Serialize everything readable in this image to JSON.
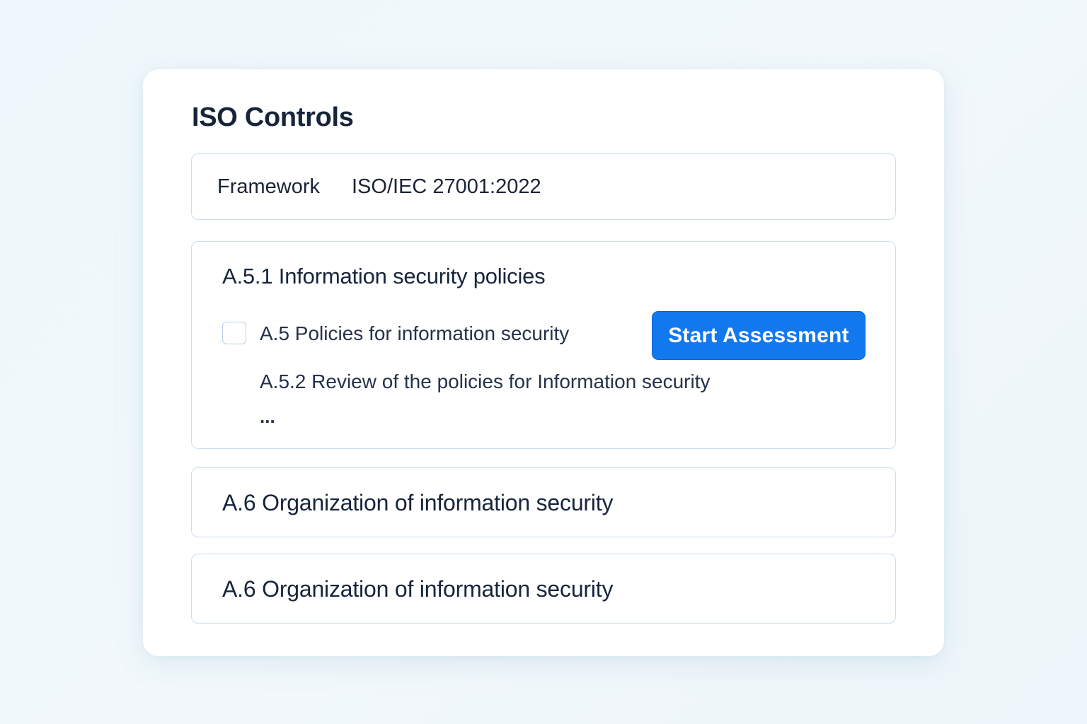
{
  "page": {
    "title": "ISO Controls"
  },
  "framework": {
    "label": "Framework",
    "value": "ISO/IEC 27001:2022"
  },
  "controls": [
    {
      "title": "A.5.1 Information security policies",
      "items": [
        {
          "label": "A.5 Policies for information security",
          "checked": false
        },
        {
          "label": "A.5.2 Review of the policies for Information security"
        }
      ],
      "more": "...",
      "action_label": "Start Assessment"
    }
  ],
  "sections": [
    {
      "title": "A.6 Organization of information security"
    },
    {
      "title": "A.6 Organization of information security"
    }
  ],
  "colors": {
    "accent": "#1278ee",
    "panel_border": "#c9def0",
    "text": "#17253b",
    "background": "#eef7fb"
  }
}
